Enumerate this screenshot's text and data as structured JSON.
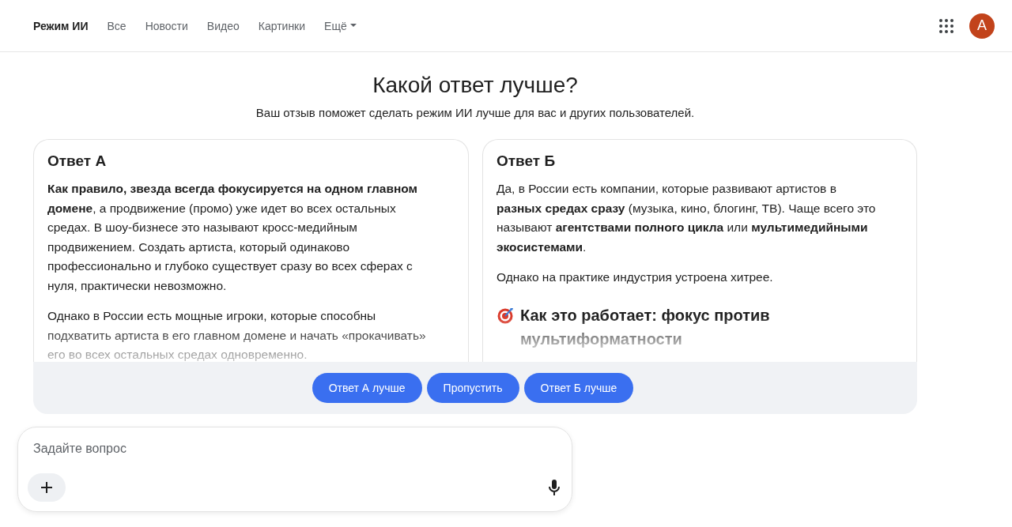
{
  "nav": {
    "tabs": [
      {
        "label": "Режим ИИ",
        "selected": true,
        "kind": "tab"
      },
      {
        "label": "Все",
        "selected": false,
        "kind": "tab"
      },
      {
        "label": "Новости",
        "selected": false,
        "kind": "tab"
      },
      {
        "label": "Видео",
        "selected": false,
        "kind": "tab"
      },
      {
        "label": "Картинки",
        "selected": false,
        "kind": "tab"
      },
      {
        "label": "Ещё",
        "selected": false,
        "kind": "dropdown"
      }
    ]
  },
  "account": {
    "initial": "A"
  },
  "title": "Какой ответ лучше?",
  "subtitle": "Ваш отзыв поможет сделать режим ИИ лучше для вас и других пользователей.",
  "answers": [
    {
      "title": "Ответ А",
      "blocks": [
        {
          "kind": "paragraph",
          "text": "**Как правило, звезда всегда фокусируется на одном главном домене**, а продвижение (промо) уже идет во всех остальных средах. В шоу-бизнесе это называют кросс-медийным продвижением. Создать артиста, который одинаково профессионально и глубоко существует сразу во всех сферах с нуля, практически невозможно."
        },
        {
          "kind": "paragraph",
          "text": "Однако в России есть мощные игроки, которые способны подхватить артиста в его главном домене и начать «прокачивать» его во всех остальных средах одновременно."
        }
      ]
    },
    {
      "title": "Ответ Б",
      "blocks": [
        {
          "kind": "paragraph",
          "text": "Да, в России есть компании, которые развивают артистов в **разных средах сразу** (музыка, кино, блогинг, ТВ). Чаще всего это называют **агентствами полного цикла** или **мультимедийными экосистемами**."
        },
        {
          "kind": "paragraph",
          "text": "Однако на практике индустрия устроена хитрее."
        },
        {
          "kind": "heading",
          "text": "Как это работает: фокус против мультиформатности"
        }
      ]
    }
  ],
  "vote_buttons": [
    "Ответ А лучше",
    "Пропустить",
    "Ответ Б лучше"
  ],
  "composer": {
    "placeholder": "Задайте вопрос"
  }
}
